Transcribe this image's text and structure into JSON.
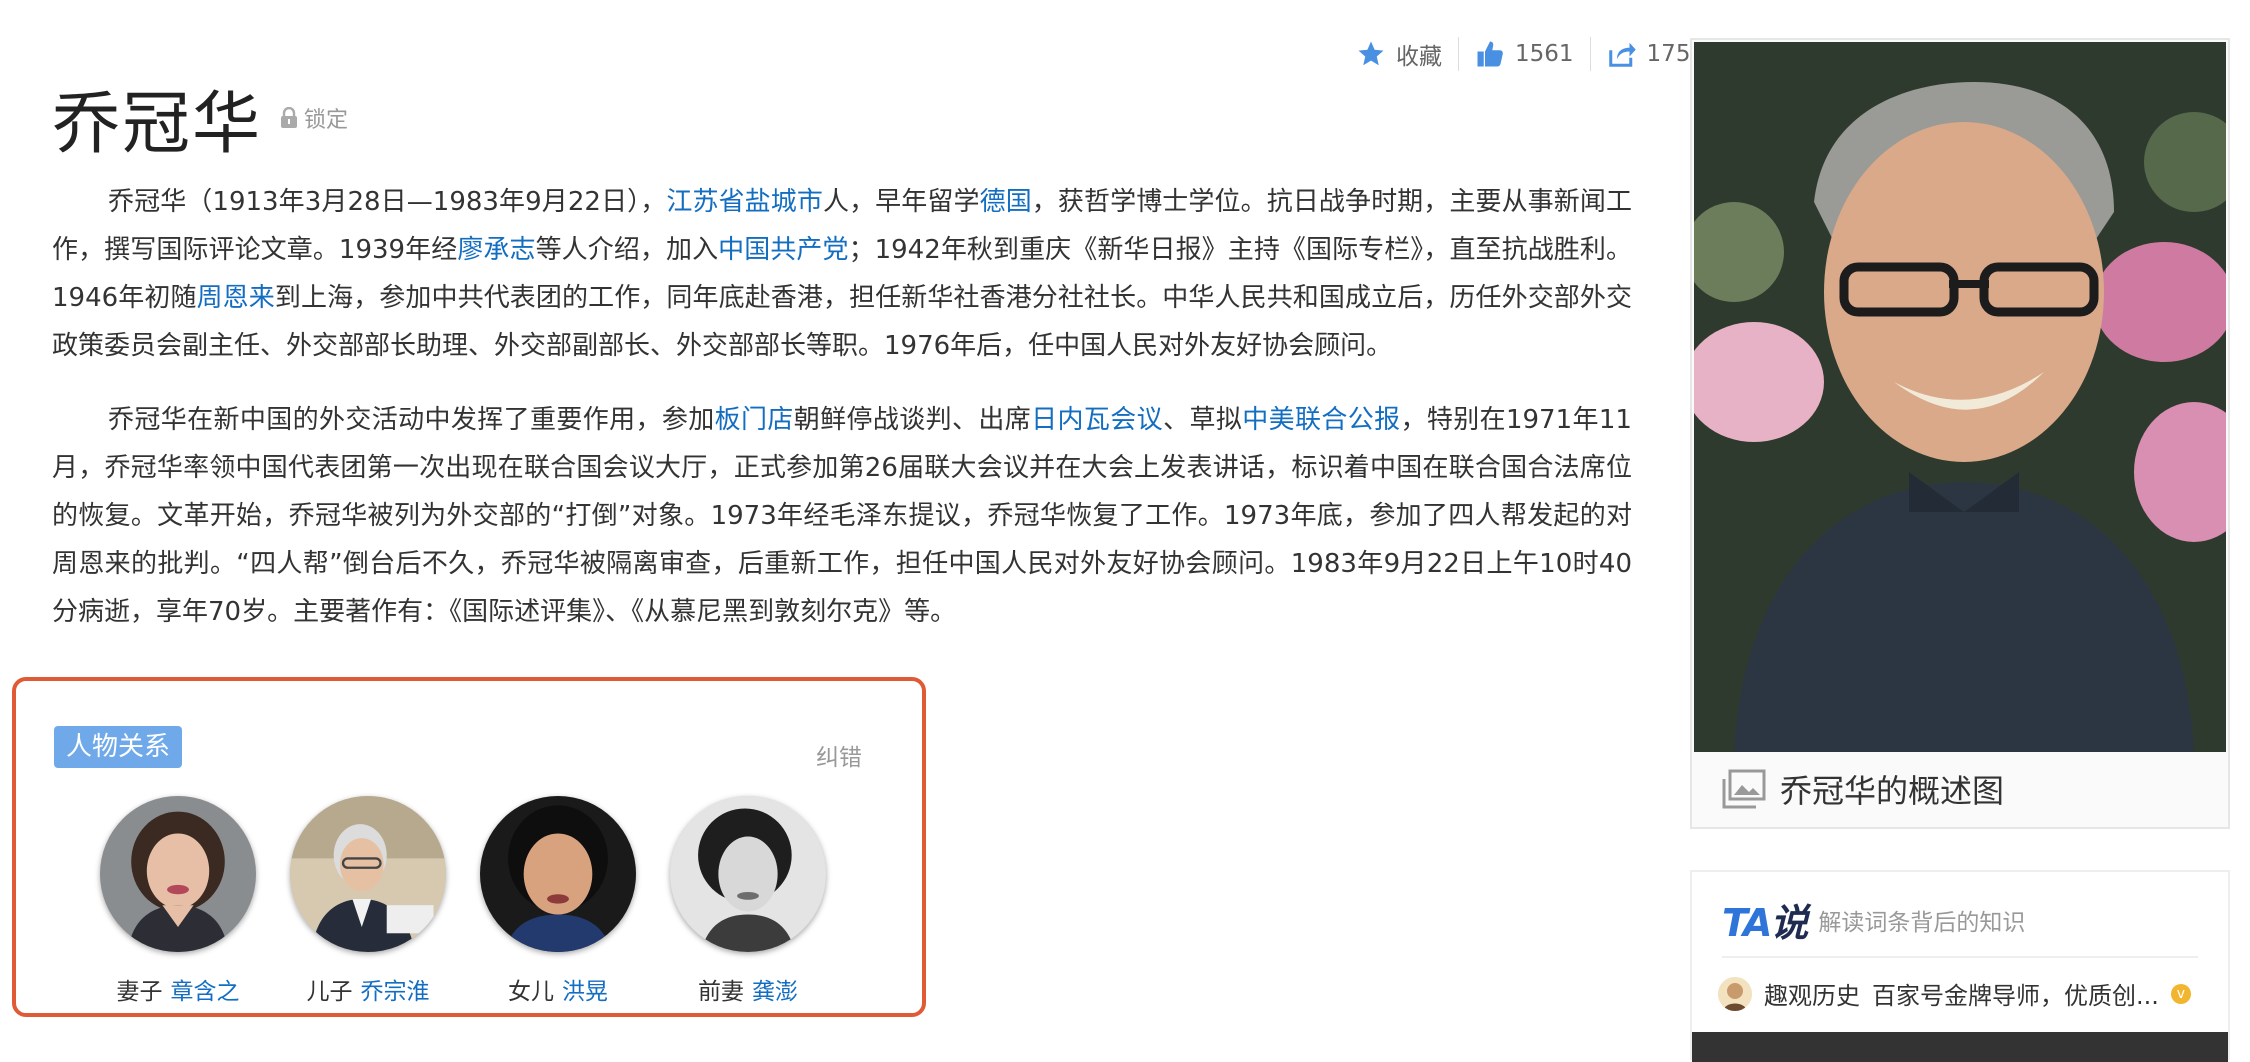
{
  "title": "乔冠华",
  "lock_label": "锁定",
  "actions": {
    "collect_label": "收藏",
    "like_count": "1561",
    "share_count": "175"
  },
  "summary": {
    "paragraphs": [
      [
        {
          "text": "乔冠华（1913年3月28日—1983年9月22日），"
        },
        {
          "text": "江苏省盐城市",
          "link": true
        },
        {
          "text": "人，早年留学"
        },
        {
          "text": "德国",
          "link": true
        },
        {
          "text": "，获哲学博士学位。抗日战争时期，主要从事新闻工作，撰写国际评论文章。1939年经"
        },
        {
          "text": "廖承志",
          "link": true
        },
        {
          "text": "等人介绍，加入"
        },
        {
          "text": "中国共产党",
          "link": true
        },
        {
          "text": "；1942年秋到重庆《新华日报》主持《国际专栏》，直至抗战胜利。1946年初随"
        },
        {
          "text": "周恩来",
          "link": true
        },
        {
          "text": "到上海，参加中共代表团的工作，同年底赴香港，担任新华社香港分社社长。中华人民共和国成立后，历任外交部外交政策委员会副主任、外交部部长助理、外交部副部长、外交部部长等职。1976年后，任中国人民对外友好协会顾问。"
        }
      ],
      [
        {
          "text": "乔冠华在新中国的外交活动中发挥了重要作用，参加"
        },
        {
          "text": "板门店",
          "link": true
        },
        {
          "text": "朝鲜停战谈判、出席"
        },
        {
          "text": "日内瓦会议",
          "link": true
        },
        {
          "text": "、草拟"
        },
        {
          "text": "中美联合公报",
          "link": true
        },
        {
          "text": "，特别在1971年11月，乔冠华率领中国代表团第一次出现在联合国会议大厅，正式参加第26届联大会议并在大会上发表讲话，标识着中国在联合国合法席位的恢复。文革开始，乔冠华被列为外交部的“打倒”对象。1973年经毛泽东提议，乔冠华恢复了工作。1973年底，参加了四人帮发起的对周恩来的批判。“四人帮”倒台后不久，乔冠华被隔离审查，后重新工作，担任中国人民对外友好协会顾问。1983年9月22日上午10时40分病逝，享年70岁。主要著作有：《国际述评集》、《从慕尼黑到敦刻尔克》等。"
        }
      ]
    ]
  },
  "relations": {
    "tag": "人物关系",
    "correct_label": "纠错",
    "people": [
      {
        "relation": "妻子",
        "name": "章含之"
      },
      {
        "relation": "儿子",
        "name": "乔宗淮"
      },
      {
        "relation": "女儿",
        "name": "洪晃"
      },
      {
        "relation": "前妻",
        "name": "龚澎"
      }
    ]
  },
  "portrait": {
    "caption": "乔冠华的概述图"
  },
  "ta": {
    "logo_ta": "TA",
    "logo_shuo": "说",
    "subtitle": "解读词条背后的知识",
    "author": "趣观历史",
    "author_desc": "百家号金牌导师，优质创...",
    "badge": "v"
  },
  "colors": {
    "link": "#136ec2",
    "relation_border": "#e05a35",
    "tag_bg": "#6fa9ea",
    "action_icon": "#4a90e2"
  }
}
